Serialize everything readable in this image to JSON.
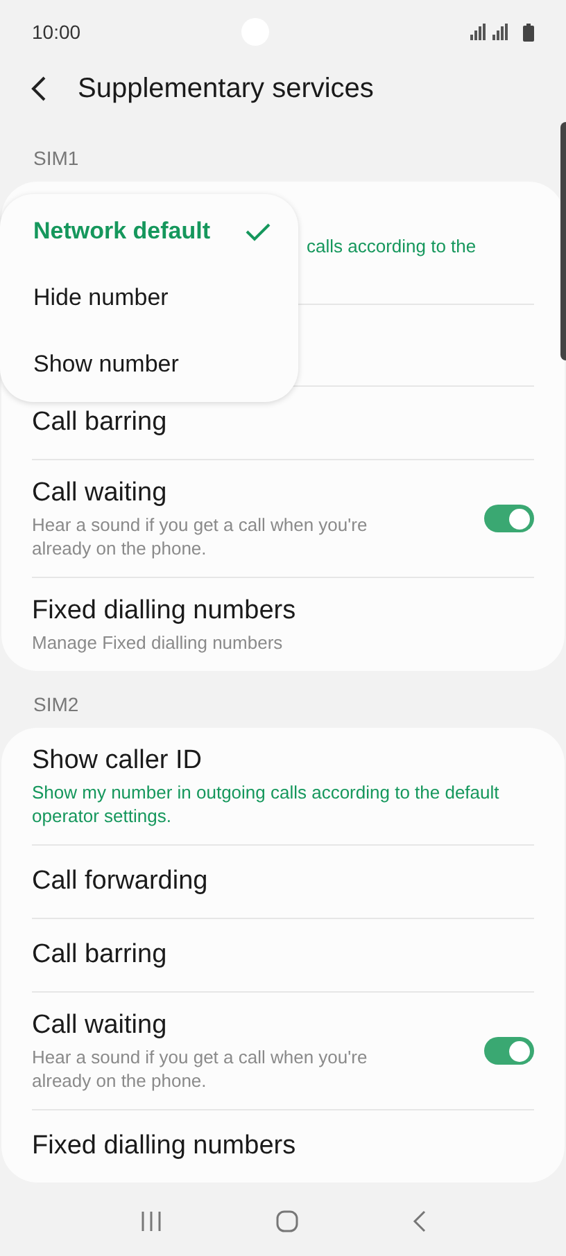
{
  "status_bar": {
    "time": "10:00"
  },
  "header": {
    "title": "Supplementary services"
  },
  "sections": [
    {
      "label": "SIM1",
      "rows": [
        {
          "kind": "partial",
          "subtitle": "calls according to the",
          "accent": true
        },
        {
          "kind": "covered"
        },
        {
          "kind": "plain",
          "title": "Call barring"
        },
        {
          "kind": "toggle",
          "title": "Call waiting",
          "subtitle": "Hear a sound if you get a call when you're already on the phone.",
          "on": true
        },
        {
          "kind": "plain",
          "title": "Fixed dialling numbers",
          "subtitle": "Manage Fixed dialling numbers",
          "accent": false
        }
      ]
    },
    {
      "label": "SIM2",
      "rows": [
        {
          "kind": "plain",
          "title": "Show caller ID",
          "subtitle": "Show my number in outgoing calls according to the default operator settings.",
          "accent": true
        },
        {
          "kind": "plain",
          "title": "Call forwarding"
        },
        {
          "kind": "plain",
          "title": "Call barring"
        },
        {
          "kind": "toggle",
          "title": "Call waiting",
          "subtitle": "Hear a sound if you get a call when you're already on the phone.",
          "on": true
        },
        {
          "kind": "plain",
          "title": "Fixed dialling numbers"
        }
      ]
    }
  ],
  "popup": {
    "options": [
      {
        "label": "Network default",
        "selected": true
      },
      {
        "label": "Hide number",
        "selected": false
      },
      {
        "label": "Show number",
        "selected": false
      }
    ]
  }
}
